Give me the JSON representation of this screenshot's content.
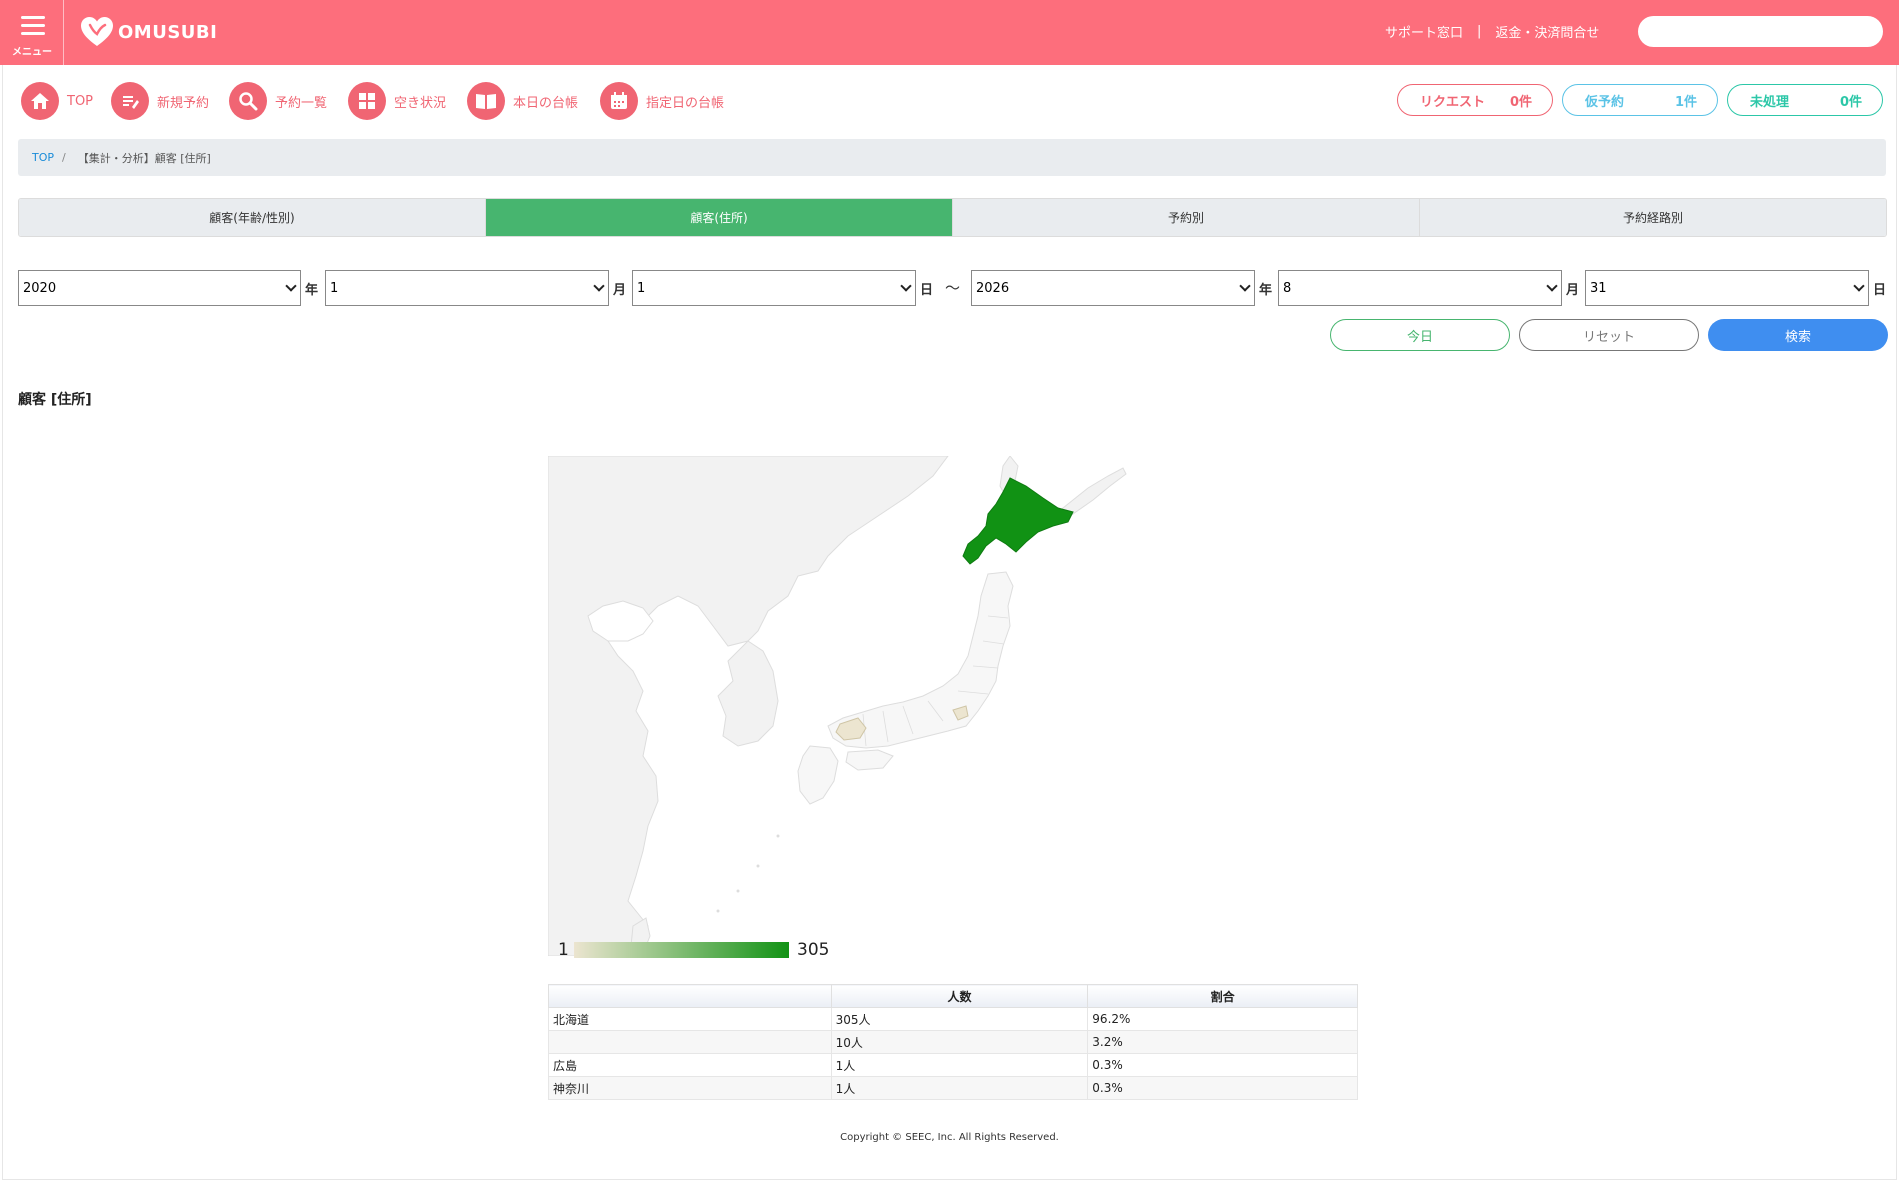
{
  "header": {
    "menu_label": "メニュー",
    "logo_text": "OMUSUBI",
    "links": [
      "サポート窓口",
      "返金・決済問合せ"
    ],
    "link_sep": "|",
    "search_placeholder": "",
    "bg_color": "#fd6e7c"
  },
  "nav": [
    {
      "label": "TOP",
      "icon": "home-icon"
    },
    {
      "label": "新規予約",
      "icon": "edit-icon"
    },
    {
      "label": "予約一覧",
      "icon": "search-icon"
    },
    {
      "label": "空き状況",
      "icon": "grid-icon"
    },
    {
      "label": "本日の台帳",
      "icon": "book-icon"
    },
    {
      "label": "指定日の台帳",
      "icon": "calendar-icon"
    }
  ],
  "badges": [
    {
      "label": "リクエスト",
      "count": "0件",
      "color": "#f06573"
    },
    {
      "label": "仮予約",
      "count": "1件",
      "color": "#5bc3e6"
    },
    {
      "label": "未処理",
      "count": "0件",
      "color": "#2cc7a8"
    }
  ],
  "breadcrumb": {
    "home": "TOP",
    "sep": "/",
    "current": "【集計・分析】顧客 [住所]"
  },
  "tabs": [
    {
      "label": "顧客(年齢/性別)",
      "active": false
    },
    {
      "label": "顧客(住所)",
      "active": true
    },
    {
      "label": "予約別",
      "active": false
    },
    {
      "label": "予約経路別",
      "active": false
    }
  ],
  "date_range": {
    "from": {
      "year": "2020",
      "month": "1",
      "day": "1"
    },
    "to": {
      "year": "2026",
      "month": "8",
      "day": "31"
    },
    "unit_year": "年",
    "unit_month": "月",
    "unit_day": "日",
    "tilde": "〜"
  },
  "buttons": {
    "today": "今日",
    "reset": "リセット",
    "search": "検索"
  },
  "section_title": "顧客 [住所]",
  "chart_data": {
    "type": "geo",
    "region": "JP",
    "colorAxis": {
      "min": 1,
      "max": 305,
      "colors": [
        "#ece5d0",
        "#119214"
      ]
    },
    "legend": {
      "min_label": "1",
      "max_label": "305"
    },
    "regions": [
      {
        "name": "北海道",
        "value": 305
      },
      {
        "name": "広島",
        "value": 1
      },
      {
        "name": "神奈川",
        "value": 1
      }
    ]
  },
  "table": {
    "headers": [
      "",
      "人数",
      "割合"
    ],
    "rows": [
      [
        "北海道",
        "305人",
        "96.2%"
      ],
      [
        "",
        "10人",
        "3.2%"
      ],
      [
        "広島",
        "1人",
        "0.3%"
      ],
      [
        "神奈川",
        "1人",
        "0.3%"
      ]
    ]
  },
  "footer": "Copyright © SEEC, Inc. All Rights Reserved."
}
